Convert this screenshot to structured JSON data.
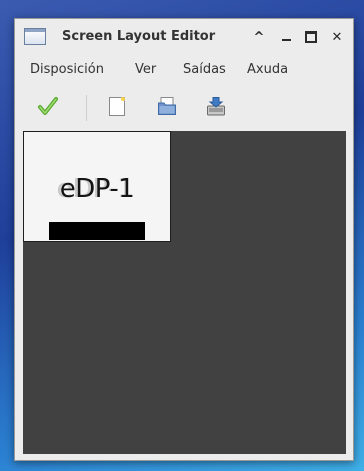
{
  "window": {
    "title": "Screen Layout Editor",
    "controls": {
      "up": "^",
      "minimize": "minimize",
      "maximize": "maximize",
      "close": "✕"
    }
  },
  "menubar": {
    "items": [
      "Disposición",
      "Ver",
      "Saídas",
      "Axuda"
    ]
  },
  "toolbar": {
    "icons": [
      "checkmark-icon",
      "new-document-icon",
      "open-folder-icon",
      "save-icon"
    ]
  },
  "layout": {
    "outputs": [
      {
        "name": "eDP-1"
      }
    ]
  },
  "colors": {
    "canvas_bg": "#414141",
    "window_bg": "#ececec",
    "monitor_bg": "#f5f5f5",
    "check_green": "#5aa832"
  }
}
